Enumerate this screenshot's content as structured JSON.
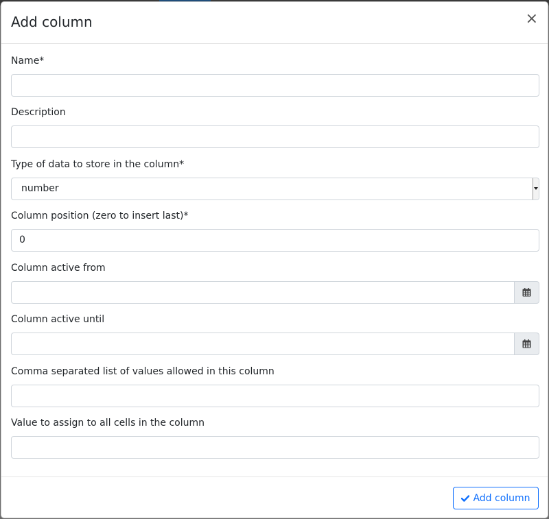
{
  "modal": {
    "title": "Add column",
    "close_glyph": "×"
  },
  "fields": {
    "name": {
      "label": "Name*",
      "value": ""
    },
    "description": {
      "label": "Description",
      "value": ""
    },
    "data_type": {
      "label": "Type of data to store in the column*",
      "value": "number"
    },
    "position": {
      "label": "Column position (zero to insert last)*",
      "value": "0"
    },
    "active_from": {
      "label": "Column active from",
      "value": ""
    },
    "active_until": {
      "label": "Column active until",
      "value": ""
    },
    "allowed_values": {
      "label": "Comma separated list of values allowed in this column",
      "value": ""
    },
    "initial_value": {
      "label": "Value to assign to all cells in the column",
      "value": ""
    }
  },
  "footer": {
    "submit_label": "Add column"
  },
  "icons": {
    "close": "close-icon",
    "calendar": "calendar-icon",
    "check": "check-icon",
    "select_arrow": "chevron-down-icon"
  },
  "colors": {
    "primary": "#0d6efd",
    "border": "#ced4da",
    "addon_bg": "#e9ecef"
  }
}
